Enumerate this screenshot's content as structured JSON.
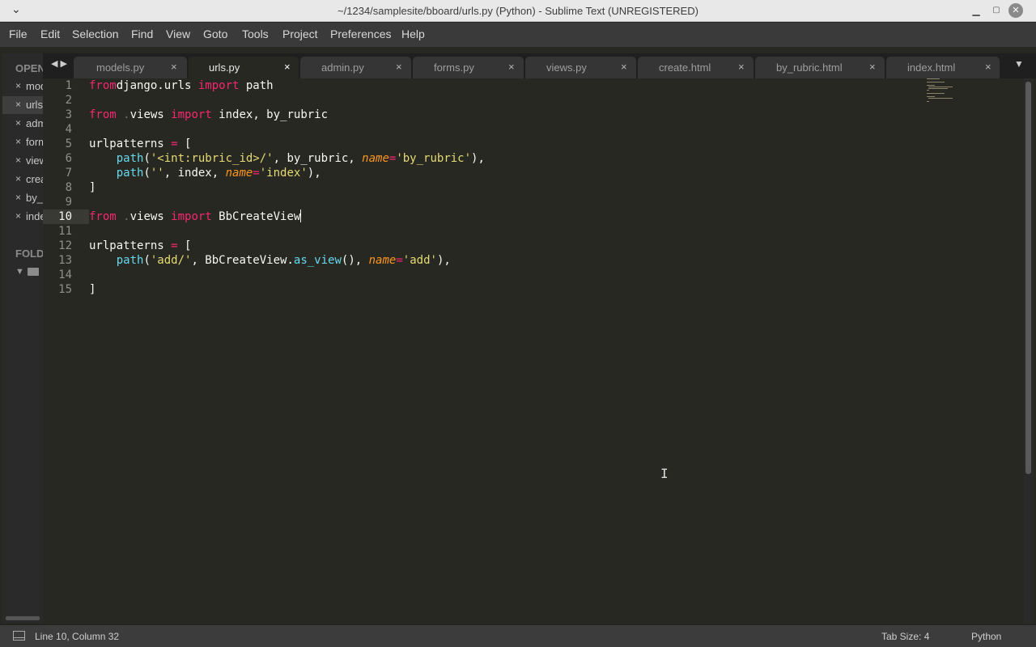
{
  "window": {
    "menu_glyph": "⌄",
    "title": "~/1234/samplesite/bboard/urls.py (Python) - Sublime Text (UNREGISTERED)",
    "min_glyph": "▁",
    "max_glyph": "▢",
    "close_glyph": "✕"
  },
  "menubar": [
    "File",
    "Edit",
    "Selection",
    "Find",
    "View",
    "Goto",
    "Tools",
    "Project",
    "Preferences",
    "Help"
  ],
  "sidebar": {
    "open_files_title": "OPEN FILES",
    "nav_arrows": "◀ ▶",
    "files": [
      {
        "label": "models.py",
        "active": false
      },
      {
        "label": "urls.py",
        "active": true
      },
      {
        "label": "admin.py",
        "active": false
      },
      {
        "label": "forms.py",
        "active": false
      },
      {
        "label": "views.py",
        "active": false
      },
      {
        "label": "create.html",
        "active": false
      },
      {
        "label": "by_rubric.html",
        "active": false
      },
      {
        "label": "index.html",
        "active": false
      }
    ],
    "close_glyph": "×",
    "folders_title": "FOLDERS",
    "folder_toggle": "▼"
  },
  "tabs": [
    {
      "label": "models.py",
      "active": false
    },
    {
      "label": "urls.py",
      "active": true
    },
    {
      "label": "admin.py",
      "active": false
    },
    {
      "label": "forms.py",
      "active": false
    },
    {
      "label": "views.py",
      "active": false
    },
    {
      "label": "create.html",
      "active": false
    },
    {
      "label": "by_rubric.html",
      "active": false
    },
    {
      "label": "index.html",
      "active": false
    }
  ],
  "tab_close_glyph": "×",
  "tab_overflow_glyph": "▼",
  "editor": {
    "current_line": 10,
    "lines": [
      [
        [
          "kw",
          "from"
        ],
        [
          "",
          "django.urls "
        ],
        [
          "kw",
          "import"
        ],
        [
          "",
          " path"
        ]
      ],
      [],
      [
        [
          "kw",
          "from"
        ],
        [
          "",
          " "
        ],
        [
          "dot",
          "."
        ],
        [
          "",
          "views "
        ],
        [
          "kw",
          "import"
        ],
        [
          "",
          " index, by_rubric"
        ]
      ],
      [],
      [
        [
          "",
          "urlpatterns "
        ],
        [
          "kw",
          "="
        ],
        [
          "",
          " ["
        ]
      ],
      [
        [
          "",
          "    "
        ],
        [
          "fn",
          "path"
        ],
        [
          "",
          "("
        ],
        [
          "str",
          "'<int:rubric_id>/'"
        ],
        [
          "",
          ", by_rubric, "
        ],
        [
          "arg",
          "name"
        ],
        [
          "kw",
          "="
        ],
        [
          "str",
          "'by_rubric'"
        ],
        [
          "",
          "),"
        ]
      ],
      [
        [
          "",
          "    "
        ],
        [
          "fn",
          "path"
        ],
        [
          "",
          "("
        ],
        [
          "str",
          "''"
        ],
        [
          "",
          ", index, "
        ],
        [
          "arg",
          "name"
        ],
        [
          "kw",
          "="
        ],
        [
          "str",
          "'index'"
        ],
        [
          "",
          "),"
        ]
      ],
      [
        [
          "",
          "]"
        ]
      ],
      [],
      [
        [
          "kw",
          "from"
        ],
        [
          "",
          " "
        ],
        [
          "dot",
          "."
        ],
        [
          "",
          "views "
        ],
        [
          "kw",
          "import"
        ],
        [
          "",
          " BbCreateView"
        ]
      ],
      [],
      [
        [
          "",
          "urlpatterns "
        ],
        [
          "kw",
          "="
        ],
        [
          "",
          " ["
        ]
      ],
      [
        [
          "",
          "    "
        ],
        [
          "fn",
          "path"
        ],
        [
          "",
          "("
        ],
        [
          "str",
          "'add/'"
        ],
        [
          "",
          ", BbCreateView."
        ],
        [
          "fn",
          "as_view"
        ],
        [
          "",
          "(), "
        ],
        [
          "arg",
          "name"
        ],
        [
          "kw",
          "="
        ],
        [
          "str",
          "'add'"
        ],
        [
          "",
          "),"
        ]
      ],
      [],
      [
        [
          "",
          "]"
        ]
      ]
    ]
  },
  "cursor_glyph": "I",
  "status": {
    "position": "Line 10, Column 32",
    "tab_size": "Tab Size: 4",
    "syntax": "Python"
  },
  "colors": {
    "background": "#272822",
    "keyword": "#f92672",
    "string": "#e6db74",
    "function": "#66d9ef",
    "argument": "#fd971f"
  }
}
